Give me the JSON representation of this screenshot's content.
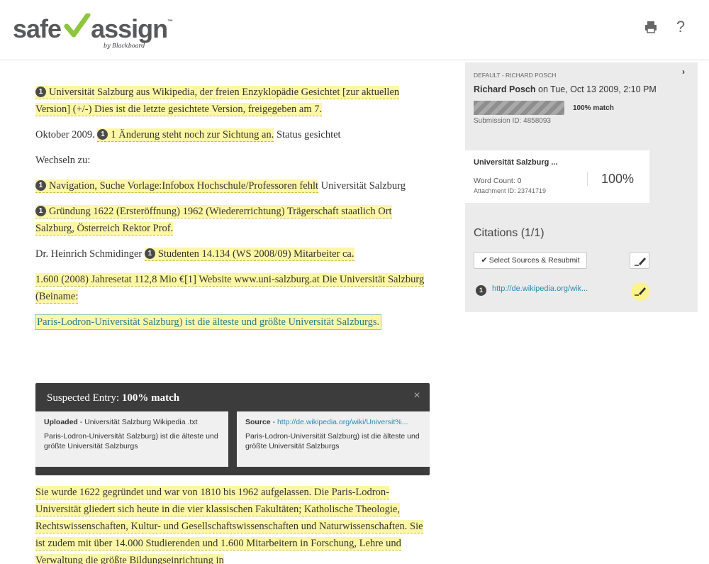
{
  "header": {
    "logo_safe": "safe",
    "logo_assign": "assign",
    "logo_tm": "™",
    "logo_by": "by Blackboard",
    "print_icon": "print-icon",
    "help_label": "?"
  },
  "document": {
    "paragraphs": [
      {
        "badge": "1",
        "text_hl": "Universität Salzburg aus Wikipedia, der freien Enzyklopädie Gesichtet [zur aktuellen Version] (+/-) Dies ist die letzte gesichtete Version, freigegeben am 7."
      },
      {
        "pre": "Oktober 2009. ",
        "badge": "1",
        "text_hl": "1 Änderung steht noch zur Sichtung an.",
        "post": " Status gesichtet"
      },
      {
        "plain": "Wechseln zu:"
      },
      {
        "badge": "1",
        "text_hl": "Navigation, Suche Vorlage:Infobox Hochschule/Professoren fehlt",
        "post": " Universität Salzburg"
      },
      {
        "badge": "1",
        "text_hl": "Gründung 1622 (Ersteröffnung) 1962 (Wiedererrichtung) Trägerschaft staatlich Ort Salzburg, Österreich Rektor Prof."
      },
      {
        "pre": "Dr. Heinrich Schmidinger ",
        "badge": "1",
        "text_hl": "Studenten 14.134 (WS 2008/09) Mitarbeiter ca."
      },
      {
        "text_hl": "1.600 (2008) Jahresetat 112,8 Mio €[1] Website www.uni-salzburg.at  Die Universität Salzburg (Beiname:"
      },
      {
        "text_sel": "Paris-Lodron-Universität Salzburg) ist die älteste und größte Universität Salzburgs."
      }
    ],
    "after_panel": "Sie wurde 1622 gegründet und war von 1810 bis 1962 aufgelassen.  Die Paris-Lodron-Universität gliedert sich heute in die vier klassischen Fakultäten;  Katholische Theologie, Rechtswissenschaften, Kultur- und Gesellschaftswissenschaften und Naturwissenschaften.  Sie ist zudem mit über 14.000 Studierenden und 1.600 Mitarbeitern in Forschung, Lehre und Verwaltung die größte Bildungseinrichtung in"
  },
  "suspected": {
    "title_prefix": "Suspected Entry: ",
    "title_match": "100% match",
    "close": "×",
    "uploaded_label": "Uploaded",
    "uploaded_file": " - Universität Salzburg Wikipedia .txt",
    "uploaded_text": "Paris-Lodron-Universität Salzburg) ist die älteste und größte Universität Salzburgs",
    "source_label": "Source",
    "source_sep": " - ",
    "source_link": "http://de.wikipedia.org/wiki/Universit%...",
    "source_text": "Paris-Lodron-Universität Salzburg) ist die älteste und größte Universität Salzburgs"
  },
  "sidebar": {
    "collapse": "›",
    "submission_label": "DEFAULT - RICHARD POSCH",
    "author": "Richard Posch",
    "author_date": " on Tue, Oct 13 2009, 2:10 PM",
    "match_fraction": 1.0,
    "match_text": "100% match",
    "submission_id": "Submission ID: 4858093",
    "attachment": {
      "name": "Universität Salzburg ...",
      "word_count": "Word Count: 0",
      "attachment_id": "Attachment ID: 23741719",
      "percent": "100%"
    },
    "citations_title": "Citations (1/1)",
    "resubmit_label": "Select Sources & Resubmit",
    "citation_badge": "1",
    "citation_link": "http://de.wikipedia.org/wik...",
    "highlight_color": "#fdf7a5"
  }
}
